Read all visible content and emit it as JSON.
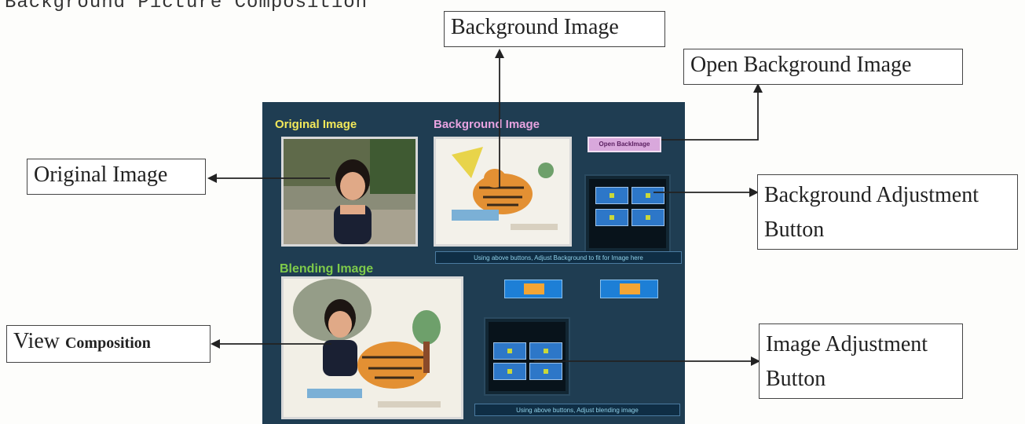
{
  "header": {
    "title": "Background Picture Composition"
  },
  "callouts": {
    "background_image": "Background Image",
    "open_background_image": "Open Background Image",
    "original_image": "Original Image",
    "background_adjustment_line1": "Background Adjustment",
    "background_adjustment_line2": "Button",
    "view_prefix": "View",
    "view_composition": "Composition",
    "image_adjustment_line1": "Image Adjustment",
    "image_adjustment_line2": "Button"
  },
  "app": {
    "original_label": "Original Image",
    "background_label": "Background Image",
    "blending_label": "Blending Image",
    "open_button": "Open BackImage",
    "background_hint": "Using above buttons, Adjust Background to fit for Image here",
    "blending_hint": "Using above buttons, Adjust blending image",
    "colors": {
      "panel": "#1f3d52",
      "original_label": "#f2e85a",
      "background_label": "#e7a3e0",
      "blending_label": "#7ecb4a"
    }
  }
}
